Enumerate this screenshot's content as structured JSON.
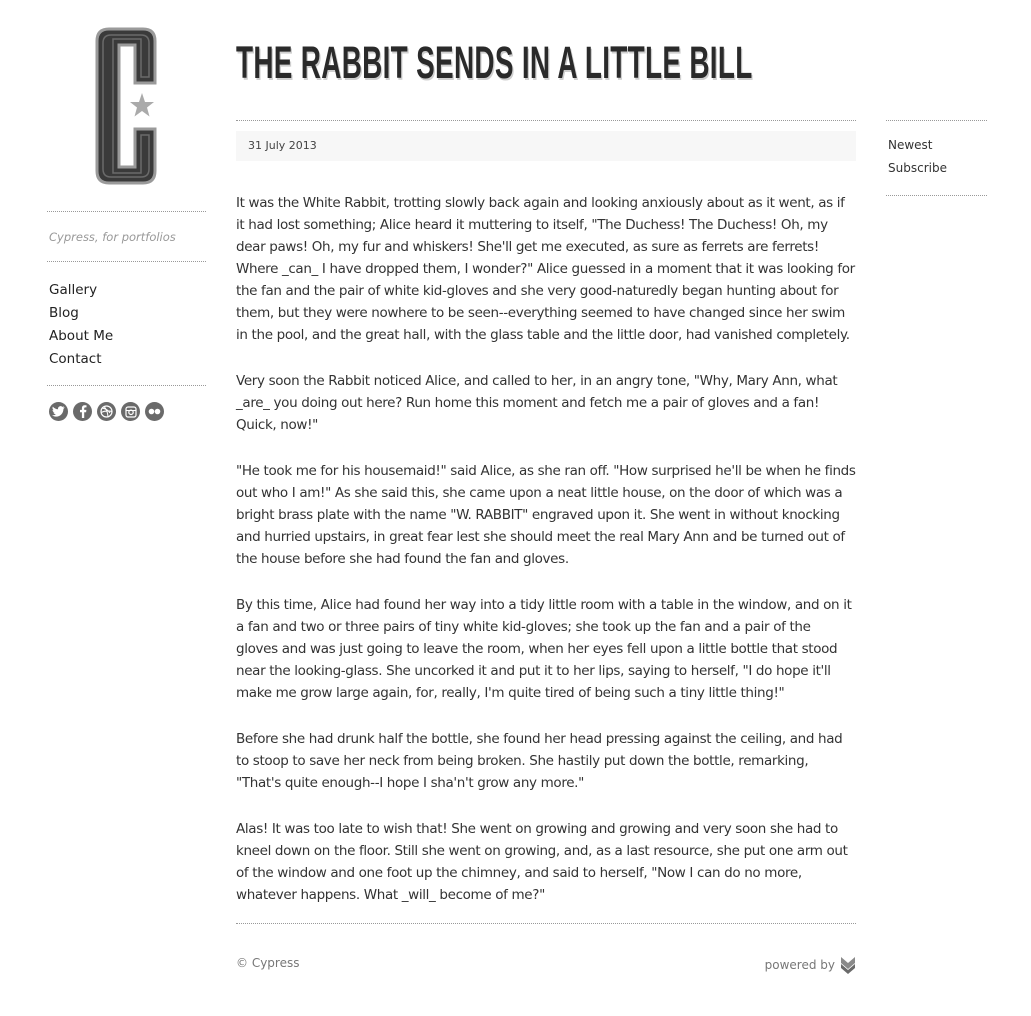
{
  "site": {
    "logo_letter": "C",
    "logo_icon": "star-icon",
    "tagline": "Cypress, for portfolios"
  },
  "nav": {
    "items": [
      {
        "label": "Gallery"
      },
      {
        "label": "Blog"
      },
      {
        "label": "About Me"
      },
      {
        "label": "Contact"
      }
    ]
  },
  "social": {
    "icons": [
      "twitter-icon",
      "facebook-icon",
      "dribbble-icon",
      "instagram-icon",
      "flickr-icon"
    ]
  },
  "post": {
    "title": "THE RABBIT SENDS IN A LITTLE BILL",
    "date": "31 July 2013",
    "paragraphs": [
      "It was the White Rabbit, trotting slowly back again and looking anxiously about as it went, as if it had lost something; Alice heard it muttering to itself, \"The Duchess! The Duchess! Oh, my dear paws! Oh, my fur and whiskers! She'll get me executed, as sure as ferrets are ferrets! Where _can_ I have dropped them, I wonder?\" Alice guessed in a moment that it was looking for the fan and the pair of white kid-gloves and she very good-naturedly began hunting about for them, but they were nowhere to be seen--everything seemed to have changed since her swim in the pool, and the great hall, with the glass table and the little door, had vanished completely.",
      "Very soon the Rabbit noticed Alice, and called to her, in an angry tone, \"Why, Mary Ann, what _are_ you doing out here? Run home this moment and fetch me a pair of gloves and a fan! Quick, now!\"",
      "\"He took me for his housemaid!\" said Alice, as she ran off. \"How surprised he'll be when he finds out who I am!\" As she said this, she came upon a neat little house, on the door of which was a bright brass plate with the name \"W. RABBIT\" engraved upon it. She went in without knocking and hurried upstairs, in great fear lest she should meet the real Mary Ann and be turned out of the house before she had found the fan and gloves.",
      "By this time, Alice had found her way into a tidy little room with a table in the window, and on it a fan and two or three pairs of tiny white kid-gloves; she took up the fan and a pair of the gloves and was just going to leave the room, when her eyes fell upon a little bottle that stood near the looking-glass. She uncorked it and put it to her lips, saying to herself, \"I do hope it'll make me grow large again, for, really, I'm quite tired of being such a tiny little thing!\"",
      "Before she had drunk half the bottle, she found her head pressing against the ceiling, and had to stoop to save her neck from being broken. She hastily put down the bottle, remarking, \"That's quite enough--I hope I sha'n't grow any more.\"",
      "Alas! It was too late to wish that! She went on growing and growing and very soon she had to kneel down on the floor. Still she went on growing, and, as a last resource, she put one arm out of the window and one foot up the chimney, and said to herself, \"Now I can do no more, whatever happens. What _will_ become of me?\""
    ]
  },
  "right_nav": {
    "items": [
      {
        "label": "Newest"
      },
      {
        "label": "Subscribe"
      }
    ]
  },
  "footer": {
    "copyright": "© Cypress",
    "powered_by": "powered by",
    "powered_icon": "koken-logo-icon"
  }
}
